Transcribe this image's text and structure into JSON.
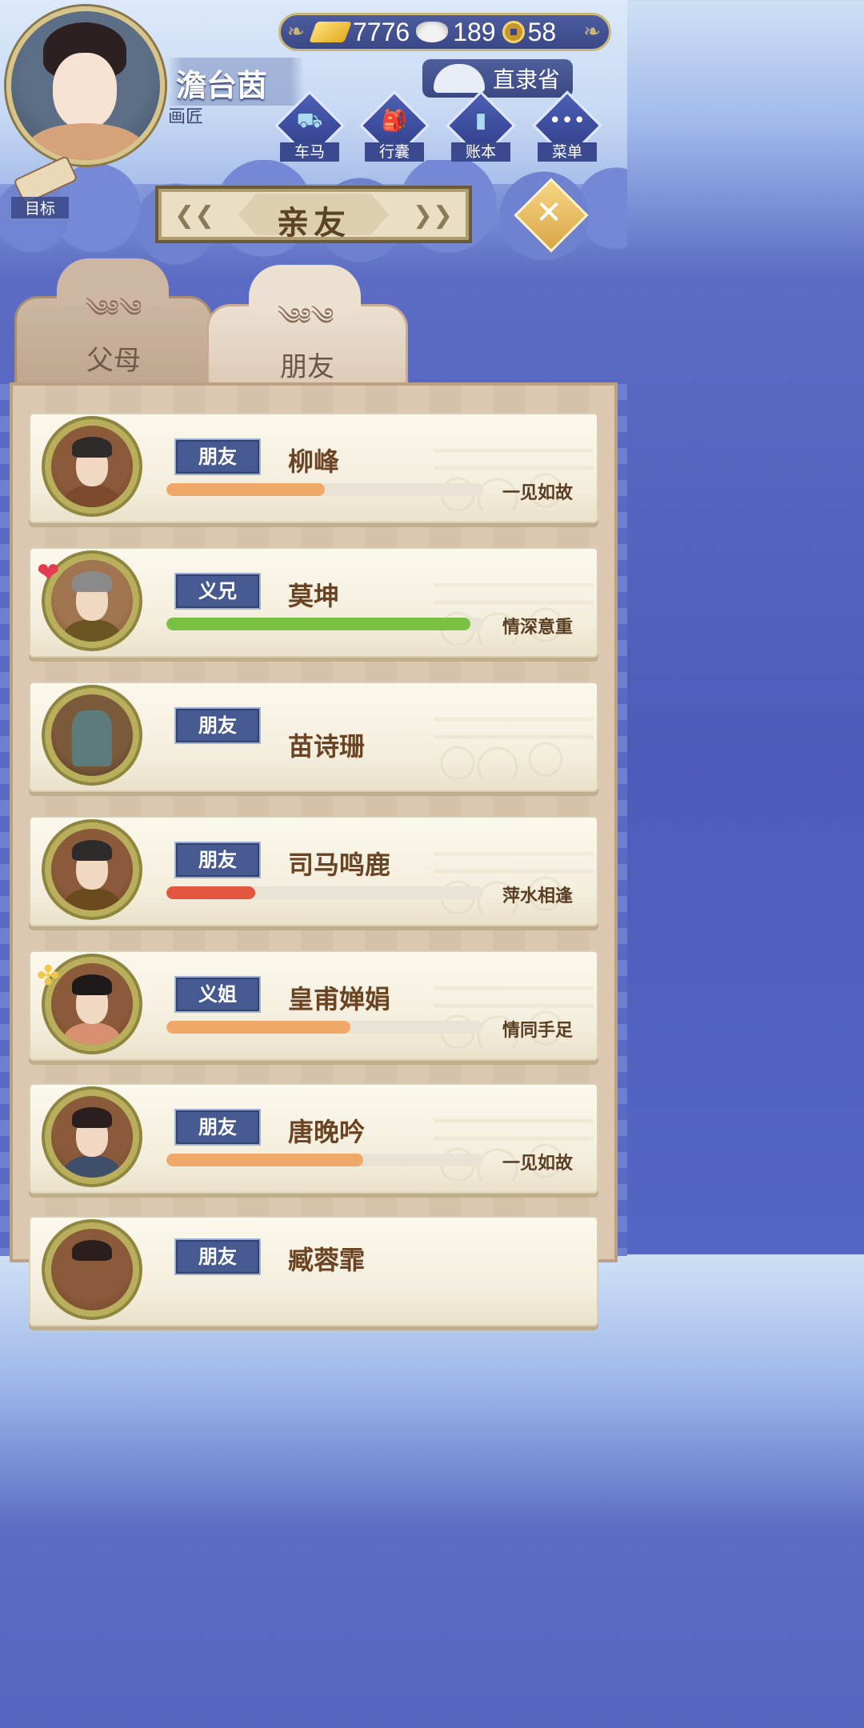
{
  "player": {
    "name": "澹台茵",
    "title": "画匠"
  },
  "currency": {
    "gold": "7776",
    "silver": "189",
    "coins": "58"
  },
  "location": {
    "province": "直隶省"
  },
  "menu": [
    {
      "label": "车马",
      "icon": "carriage-icon"
    },
    {
      "label": "行囊",
      "icon": "bag-icon"
    },
    {
      "label": "账本",
      "icon": "ledger-icon"
    },
    {
      "label": "菜单",
      "icon": "more-icon"
    }
  ],
  "goal_label": "目标",
  "screen_title": "亲友",
  "tabs": {
    "parents": "父母",
    "friends": "朋友"
  },
  "friends": [
    {
      "relation": "朋友",
      "name": "柳峰",
      "status": "一见如故",
      "affinity": 0.5,
      "bar_color": "#f0a868",
      "badge": ""
    },
    {
      "relation": "义兄",
      "name": "莫坤",
      "status": "情深意重",
      "affinity": 0.96,
      "bar_color": "#7ac143",
      "badge": "heart"
    },
    {
      "relation": "朋友",
      "name": "苗诗珊",
      "status": "",
      "affinity": null,
      "bar_color": "",
      "badge": ""
    },
    {
      "relation": "朋友",
      "name": "司马鸣鹿",
      "status": "萍水相逢",
      "affinity": 0.28,
      "bar_color": "#e2553f",
      "badge": ""
    },
    {
      "relation": "义姐",
      "name": "皇甫婵娟",
      "status": "情同手足",
      "affinity": 0.58,
      "bar_color": "#f0a868",
      "badge": "knot"
    },
    {
      "relation": "朋友",
      "name": "唐晚吟",
      "status": "一见如故",
      "affinity": 0.62,
      "bar_color": "#f0a868",
      "badge": ""
    },
    {
      "relation": "朋友",
      "name": "臧蓉霏",
      "status": "",
      "affinity": null,
      "bar_color": "",
      "badge": ""
    }
  ]
}
